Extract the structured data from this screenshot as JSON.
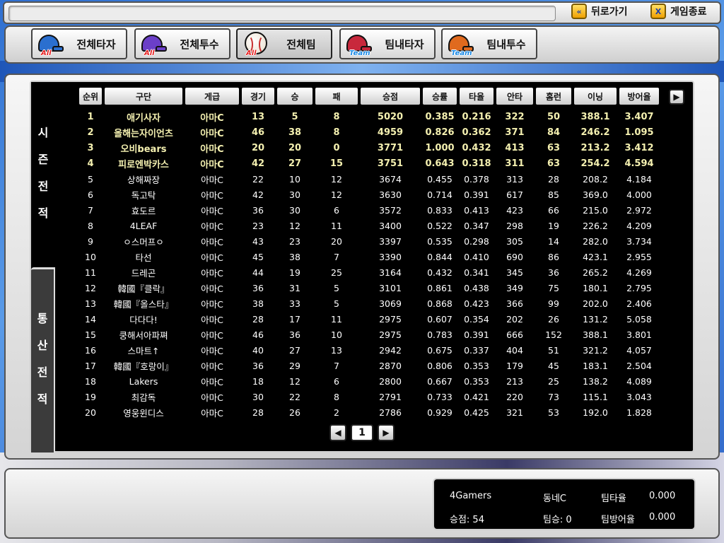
{
  "topbar": {
    "back_label": "뒤로가기",
    "exit_label": "게임종료",
    "back_icon": "«",
    "exit_icon": "X"
  },
  "tabs": [
    {
      "label": "전체타자",
      "badge": "All",
      "color": "#2b6fcf",
      "icon": "helmet-icon"
    },
    {
      "label": "전체투수",
      "badge": "All",
      "color": "#6b3fc8",
      "icon": "helmet-icon"
    },
    {
      "label": "전체팀",
      "badge": "All",
      "color": "#ffffff",
      "icon": "baseball-icon"
    },
    {
      "label": "팀내타자",
      "badge": "Team",
      "color": "#c8283c",
      "icon": "helmet-icon"
    },
    {
      "label": "팀내투수",
      "badge": "Team",
      "color": "#e06a1e",
      "icon": "helmet-icon"
    }
  ],
  "active_tab": "전체팀",
  "side_tabs": {
    "season": [
      "시",
      "즌",
      "전",
      "적"
    ],
    "total": [
      "통",
      "산",
      "전",
      "적"
    ]
  },
  "table": {
    "headers": [
      "순위",
      "구단",
      "게급",
      "경기",
      "승",
      "패",
      "승점",
      "승률",
      "타율",
      "안타",
      "홈런",
      "이닝",
      "방어율"
    ],
    "rows": [
      [
        "1",
        "애기사자",
        "아마C",
        "13",
        "5",
        "8",
        "5020",
        "0.385",
        "0.216",
        "322",
        "50",
        "388.1",
        "3.407"
      ],
      [
        "2",
        "올해는자이언츠",
        "아마C",
        "46",
        "38",
        "8",
        "4959",
        "0.826",
        "0.362",
        "371",
        "84",
        "246.2",
        "1.095"
      ],
      [
        "3",
        "오비bears",
        "아마C",
        "20",
        "20",
        "0",
        "3771",
        "1.000",
        "0.432",
        "413",
        "63",
        "213.2",
        "3.412"
      ],
      [
        "4",
        "피로엔박카스",
        "아마C",
        "42",
        "27",
        "15",
        "3751",
        "0.643",
        "0.318",
        "311",
        "63",
        "254.2",
        "4.594"
      ],
      [
        "5",
        "상해짜장",
        "아마C",
        "22",
        "10",
        "12",
        "3674",
        "0.455",
        "0.378",
        "313",
        "28",
        "208.2",
        "4.184"
      ],
      [
        "6",
        "독고탁",
        "아마C",
        "42",
        "30",
        "12",
        "3630",
        "0.714",
        "0.391",
        "617",
        "85",
        "369.0",
        "4.000"
      ],
      [
        "7",
        "효도르",
        "아마C",
        "36",
        "30",
        "6",
        "3572",
        "0.833",
        "0.413",
        "423",
        "66",
        "215.0",
        "2.972"
      ],
      [
        "8",
        "4LEAF",
        "아마C",
        "23",
        "12",
        "11",
        "3400",
        "0.522",
        "0.347",
        "298",
        "19",
        "226.2",
        "4.209"
      ],
      [
        "9",
        "ㅇ스머프ㅇ",
        "아마C",
        "43",
        "23",
        "20",
        "3397",
        "0.535",
        "0.298",
        "305",
        "14",
        "282.0",
        "3.734"
      ],
      [
        "10",
        "타선",
        "아마C",
        "45",
        "38",
        "7",
        "3390",
        "0.844",
        "0.410",
        "690",
        "86",
        "423.1",
        "2.955"
      ],
      [
        "11",
        "드레곤",
        "아마C",
        "44",
        "19",
        "25",
        "3164",
        "0.432",
        "0.341",
        "345",
        "36",
        "265.2",
        "4.269"
      ],
      [
        "12",
        "韓國『클락』",
        "아마C",
        "36",
        "31",
        "5",
        "3101",
        "0.861",
        "0.438",
        "349",
        "75",
        "180.1",
        "2.795"
      ],
      [
        "13",
        "韓國『올스타』",
        "아마C",
        "38",
        "33",
        "5",
        "3069",
        "0.868",
        "0.423",
        "366",
        "99",
        "202.0",
        "2.406"
      ],
      [
        "14",
        "다다다!",
        "아마C",
        "28",
        "17",
        "11",
        "2975",
        "0.607",
        "0.354",
        "202",
        "26",
        "131.2",
        "5.058"
      ],
      [
        "15",
        "쿵해서아파쪄",
        "아마C",
        "46",
        "36",
        "10",
        "2975",
        "0.783",
        "0.391",
        "666",
        "152",
        "388.1",
        "3.801"
      ],
      [
        "16",
        "스마트↑",
        "아마C",
        "40",
        "27",
        "13",
        "2942",
        "0.675",
        "0.337",
        "404",
        "51",
        "321.2",
        "4.057"
      ],
      [
        "17",
        "韓國『호랑이』",
        "아마C",
        "36",
        "29",
        "7",
        "2870",
        "0.806",
        "0.353",
        "179",
        "45",
        "183.1",
        "2.504"
      ],
      [
        "18",
        "Lakers",
        "아마C",
        "18",
        "12",
        "6",
        "2800",
        "0.667",
        "0.353",
        "213",
        "25",
        "138.2",
        "4.089"
      ],
      [
        "19",
        "최감독",
        "아마C",
        "30",
        "22",
        "8",
        "2791",
        "0.733",
        "0.421",
        "220",
        "73",
        "115.1",
        "3.043"
      ],
      [
        "20",
        "영웅윈디스",
        "아마C",
        "28",
        "26",
        "2",
        "2786",
        "0.929",
        "0.425",
        "321",
        "53",
        "192.0",
        "1.828"
      ]
    ],
    "highlight_color": "#f4f0b0"
  },
  "pager": {
    "prev": "◀",
    "page": "1",
    "next": "▶"
  },
  "scroll_right": "▶",
  "info": {
    "team_name": "4Gamers",
    "points": "승점: 54",
    "grade": "동네C",
    "team_wins": "팀승: 0",
    "bat_label": "팀타율",
    "bat_value": "0.000",
    "era_label": "팀방어율",
    "era_value": "0.000"
  }
}
